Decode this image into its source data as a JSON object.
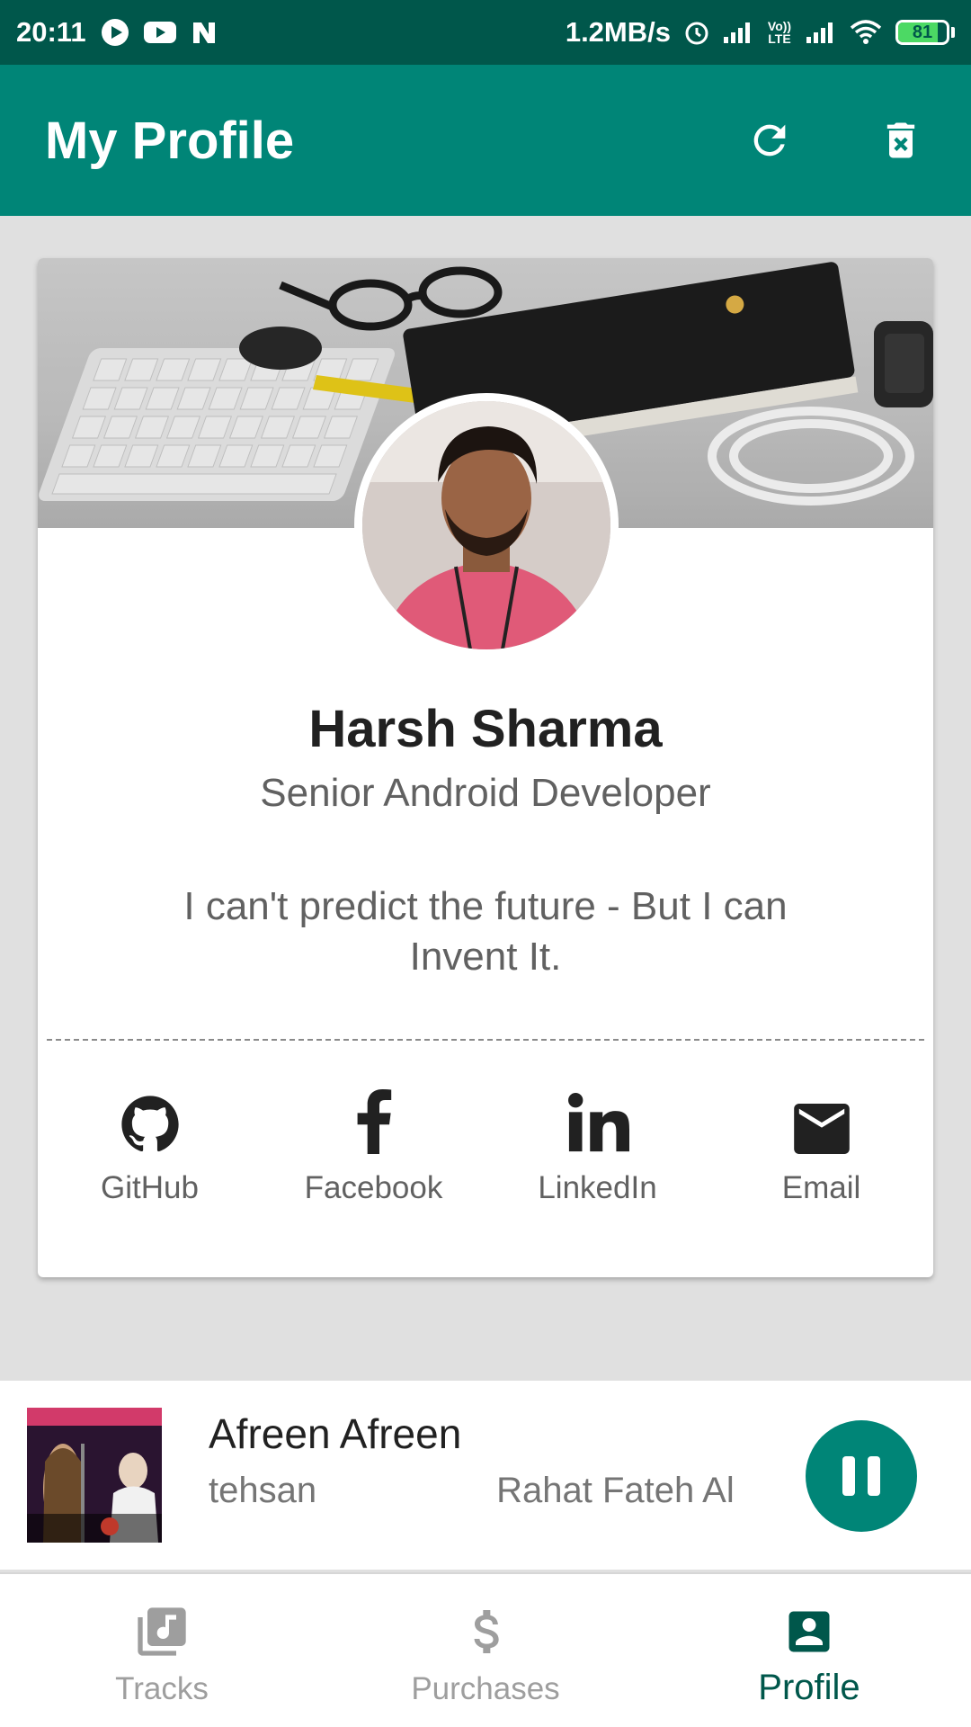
{
  "status_bar": {
    "time": "20:11",
    "speed": "1.2MB/s",
    "network_label": "Vo)) LTE",
    "battery": "81",
    "battery_level": 0.81
  },
  "app_bar": {
    "title": "My Profile",
    "icons": [
      "refresh-icon",
      "delete-icon"
    ]
  },
  "profile": {
    "name": "Harsh Sharma",
    "role": "Senior Android Developer",
    "quote": "I can't predict the future - But I can Invent It.",
    "socials": [
      {
        "label": "GitHub",
        "icon": "github-icon"
      },
      {
        "label": "Facebook",
        "icon": "facebook-icon"
      },
      {
        "label": "LinkedIn",
        "icon": "linkedin-icon"
      },
      {
        "label": "Email",
        "icon": "email-icon"
      }
    ]
  },
  "player": {
    "track": "Afreen Afreen",
    "artist_a": "tehsan",
    "artist_b": "Rahat Fateh Al"
  },
  "bottom_nav": {
    "items": [
      {
        "label": "Tracks",
        "icon": "music-library-icon",
        "active": false
      },
      {
        "label": "Purchases",
        "icon": "dollar-icon",
        "active": false
      },
      {
        "label": "Profile",
        "icon": "account-box-icon",
        "active": true
      }
    ]
  },
  "colors": {
    "primary": "#008577",
    "primary_dark": "#00574b",
    "accent": "#008577"
  }
}
